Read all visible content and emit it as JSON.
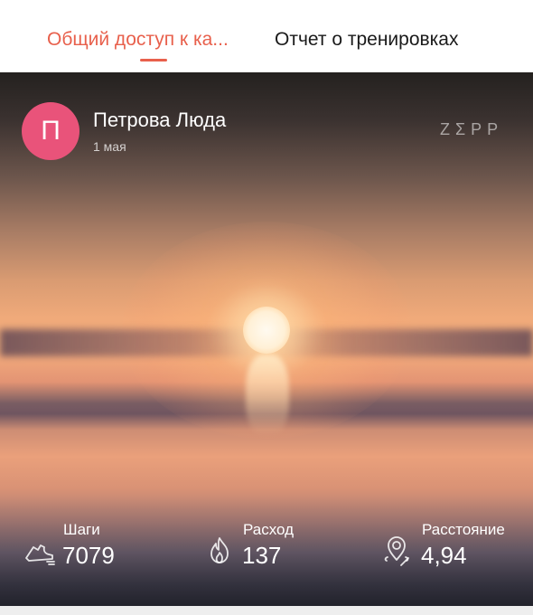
{
  "tabs": [
    {
      "label": "Общий доступ к ка...",
      "active": true
    },
    {
      "label": "Отчет о тренировках",
      "active": false
    }
  ],
  "colors": {
    "accent": "#e8604c",
    "avatar_bg": "#e9537a"
  },
  "card": {
    "avatar_initial": "П",
    "user_name": "Петрова Люда",
    "date": "1 мая",
    "brand": "ZΣPP",
    "stats": {
      "steps": {
        "label": "Шаги",
        "value": "7079",
        "icon": "sneaker-icon"
      },
      "burn": {
        "label": "Расход",
        "value": "137",
        "icon": "flame-icon"
      },
      "distance": {
        "label": "Расстояние",
        "value": "4,94",
        "icon": "location-pin-icon"
      }
    }
  }
}
